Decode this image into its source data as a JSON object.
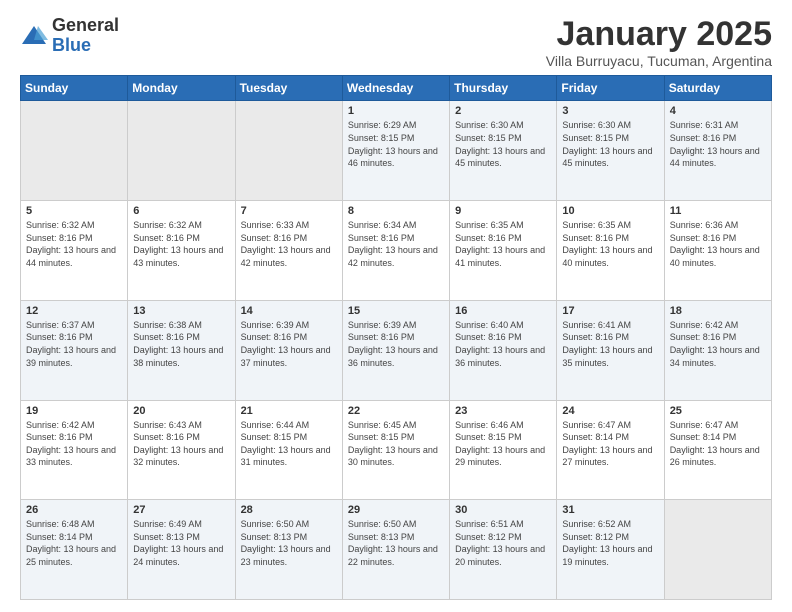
{
  "logo": {
    "general": "General",
    "blue": "Blue"
  },
  "title": "January 2025",
  "subtitle": "Villa Burruyacu, Tucuman, Argentina",
  "headers": [
    "Sunday",
    "Monday",
    "Tuesday",
    "Wednesday",
    "Thursday",
    "Friday",
    "Saturday"
  ],
  "weeks": [
    [
      {
        "day": "",
        "info": ""
      },
      {
        "day": "",
        "info": ""
      },
      {
        "day": "",
        "info": ""
      },
      {
        "day": "1",
        "info": "Sunrise: 6:29 AM\nSunset: 8:15 PM\nDaylight: 13 hours and 46 minutes."
      },
      {
        "day": "2",
        "info": "Sunrise: 6:30 AM\nSunset: 8:15 PM\nDaylight: 13 hours and 45 minutes."
      },
      {
        "day": "3",
        "info": "Sunrise: 6:30 AM\nSunset: 8:15 PM\nDaylight: 13 hours and 45 minutes."
      },
      {
        "day": "4",
        "info": "Sunrise: 6:31 AM\nSunset: 8:16 PM\nDaylight: 13 hours and 44 minutes."
      }
    ],
    [
      {
        "day": "5",
        "info": "Sunrise: 6:32 AM\nSunset: 8:16 PM\nDaylight: 13 hours and 44 minutes."
      },
      {
        "day": "6",
        "info": "Sunrise: 6:32 AM\nSunset: 8:16 PM\nDaylight: 13 hours and 43 minutes."
      },
      {
        "day": "7",
        "info": "Sunrise: 6:33 AM\nSunset: 8:16 PM\nDaylight: 13 hours and 42 minutes."
      },
      {
        "day": "8",
        "info": "Sunrise: 6:34 AM\nSunset: 8:16 PM\nDaylight: 13 hours and 42 minutes."
      },
      {
        "day": "9",
        "info": "Sunrise: 6:35 AM\nSunset: 8:16 PM\nDaylight: 13 hours and 41 minutes."
      },
      {
        "day": "10",
        "info": "Sunrise: 6:35 AM\nSunset: 8:16 PM\nDaylight: 13 hours and 40 minutes."
      },
      {
        "day": "11",
        "info": "Sunrise: 6:36 AM\nSunset: 8:16 PM\nDaylight: 13 hours and 40 minutes."
      }
    ],
    [
      {
        "day": "12",
        "info": "Sunrise: 6:37 AM\nSunset: 8:16 PM\nDaylight: 13 hours and 39 minutes."
      },
      {
        "day": "13",
        "info": "Sunrise: 6:38 AM\nSunset: 8:16 PM\nDaylight: 13 hours and 38 minutes."
      },
      {
        "day": "14",
        "info": "Sunrise: 6:39 AM\nSunset: 8:16 PM\nDaylight: 13 hours and 37 minutes."
      },
      {
        "day": "15",
        "info": "Sunrise: 6:39 AM\nSunset: 8:16 PM\nDaylight: 13 hours and 36 minutes."
      },
      {
        "day": "16",
        "info": "Sunrise: 6:40 AM\nSunset: 8:16 PM\nDaylight: 13 hours and 36 minutes."
      },
      {
        "day": "17",
        "info": "Sunrise: 6:41 AM\nSunset: 8:16 PM\nDaylight: 13 hours and 35 minutes."
      },
      {
        "day": "18",
        "info": "Sunrise: 6:42 AM\nSunset: 8:16 PM\nDaylight: 13 hours and 34 minutes."
      }
    ],
    [
      {
        "day": "19",
        "info": "Sunrise: 6:42 AM\nSunset: 8:16 PM\nDaylight: 13 hours and 33 minutes."
      },
      {
        "day": "20",
        "info": "Sunrise: 6:43 AM\nSunset: 8:16 PM\nDaylight: 13 hours and 32 minutes."
      },
      {
        "day": "21",
        "info": "Sunrise: 6:44 AM\nSunset: 8:15 PM\nDaylight: 13 hours and 31 minutes."
      },
      {
        "day": "22",
        "info": "Sunrise: 6:45 AM\nSunset: 8:15 PM\nDaylight: 13 hours and 30 minutes."
      },
      {
        "day": "23",
        "info": "Sunrise: 6:46 AM\nSunset: 8:15 PM\nDaylight: 13 hours and 29 minutes."
      },
      {
        "day": "24",
        "info": "Sunrise: 6:47 AM\nSunset: 8:14 PM\nDaylight: 13 hours and 27 minutes."
      },
      {
        "day": "25",
        "info": "Sunrise: 6:47 AM\nSunset: 8:14 PM\nDaylight: 13 hours and 26 minutes."
      }
    ],
    [
      {
        "day": "26",
        "info": "Sunrise: 6:48 AM\nSunset: 8:14 PM\nDaylight: 13 hours and 25 minutes."
      },
      {
        "day": "27",
        "info": "Sunrise: 6:49 AM\nSunset: 8:13 PM\nDaylight: 13 hours and 24 minutes."
      },
      {
        "day": "28",
        "info": "Sunrise: 6:50 AM\nSunset: 8:13 PM\nDaylight: 13 hours and 23 minutes."
      },
      {
        "day": "29",
        "info": "Sunrise: 6:50 AM\nSunset: 8:13 PM\nDaylight: 13 hours and 22 minutes."
      },
      {
        "day": "30",
        "info": "Sunrise: 6:51 AM\nSunset: 8:12 PM\nDaylight: 13 hours and 20 minutes."
      },
      {
        "day": "31",
        "info": "Sunrise: 6:52 AM\nSunset: 8:12 PM\nDaylight: 13 hours and 19 minutes."
      },
      {
        "day": "",
        "info": ""
      }
    ]
  ]
}
